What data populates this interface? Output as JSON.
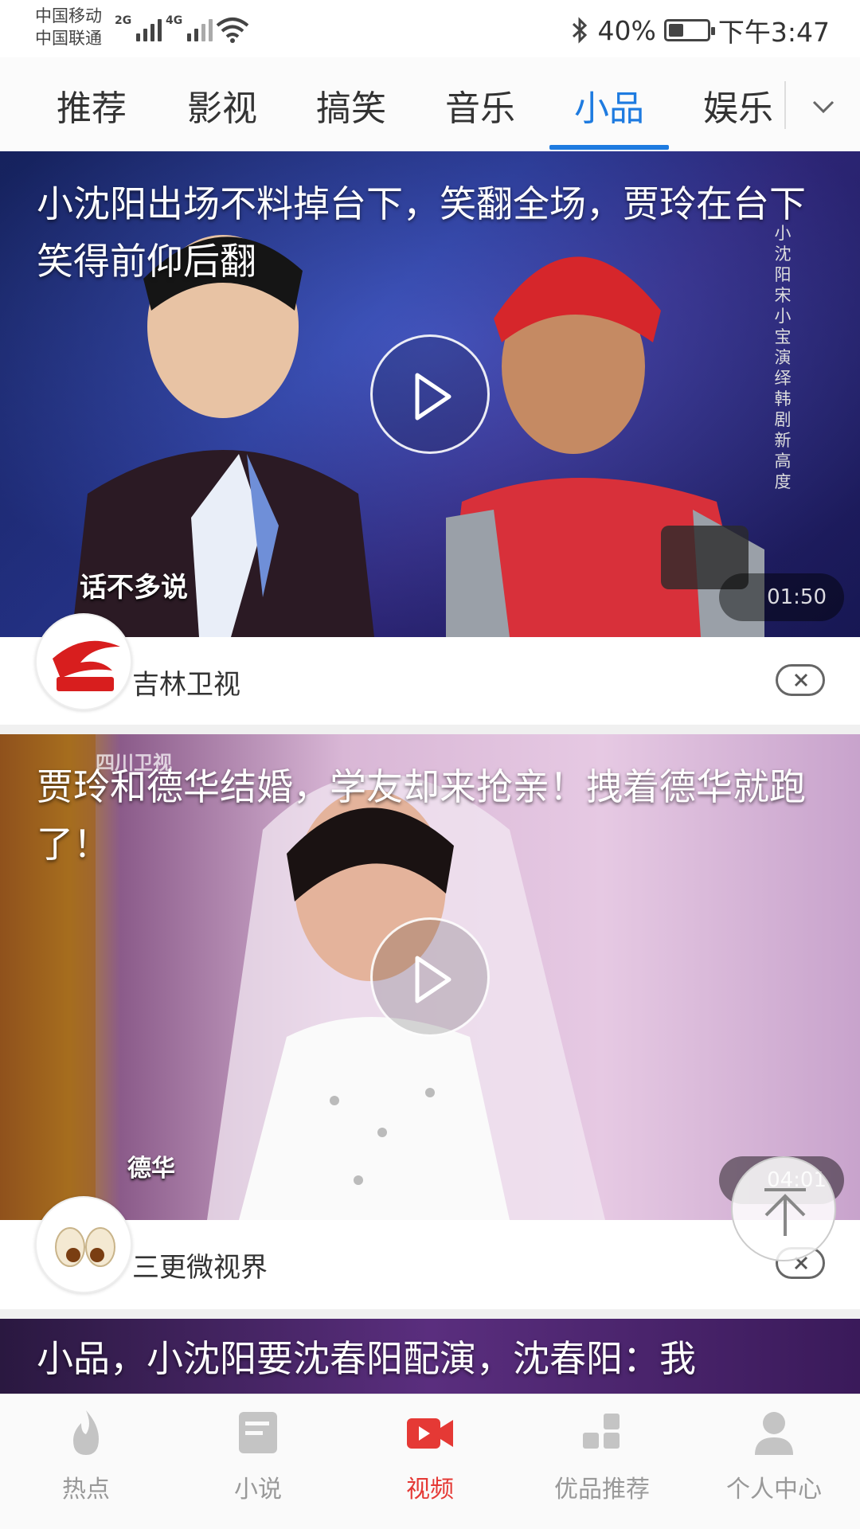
{
  "status_bar": {
    "carrier1": "中国移动",
    "carrier2": "中国联通",
    "net1": "2G",
    "net2": "4G",
    "battery": "40%",
    "battery_level": 0.4,
    "time": "下午3:47"
  },
  "tabs": [
    {
      "label": "推荐"
    },
    {
      "label": "影视"
    },
    {
      "label": "搞笑"
    },
    {
      "label": "音乐"
    },
    {
      "label": "小品",
      "active": true
    },
    {
      "label": "娱乐"
    }
  ],
  "feed": [
    {
      "title": "小沈阳出场不料掉台下，笑翻全场，贾玲在台下笑得前仰后翻",
      "duration": "01:50",
      "subtitle": "话不多说",
      "side_text": "小沈阳 宋小宝 演绎韩剧新高度",
      "source": "吉林卫视"
    },
    {
      "title": "贾玲和德华结婚，学友却来抢亲！拽着德华就跑了！",
      "duration": "04:01",
      "subtitle": "德华",
      "watermark": "四川卫视",
      "source": "三更微视界"
    },
    {
      "title": "小品，小沈阳要沈春阳配演，沈春阳：我"
    }
  ],
  "bottom_nav": [
    {
      "label": "热点",
      "icon": "flame-icon"
    },
    {
      "label": "小说",
      "icon": "notes-icon"
    },
    {
      "label": "视频",
      "icon": "video-camera-icon",
      "active": true
    },
    {
      "label": "优品推荐",
      "icon": "apps-grid-icon"
    },
    {
      "label": "个人中心",
      "icon": "person-icon"
    }
  ],
  "colors": {
    "accent": "#1e7be0",
    "nav_active": "#e53935",
    "nav_inactive": "#999999"
  }
}
